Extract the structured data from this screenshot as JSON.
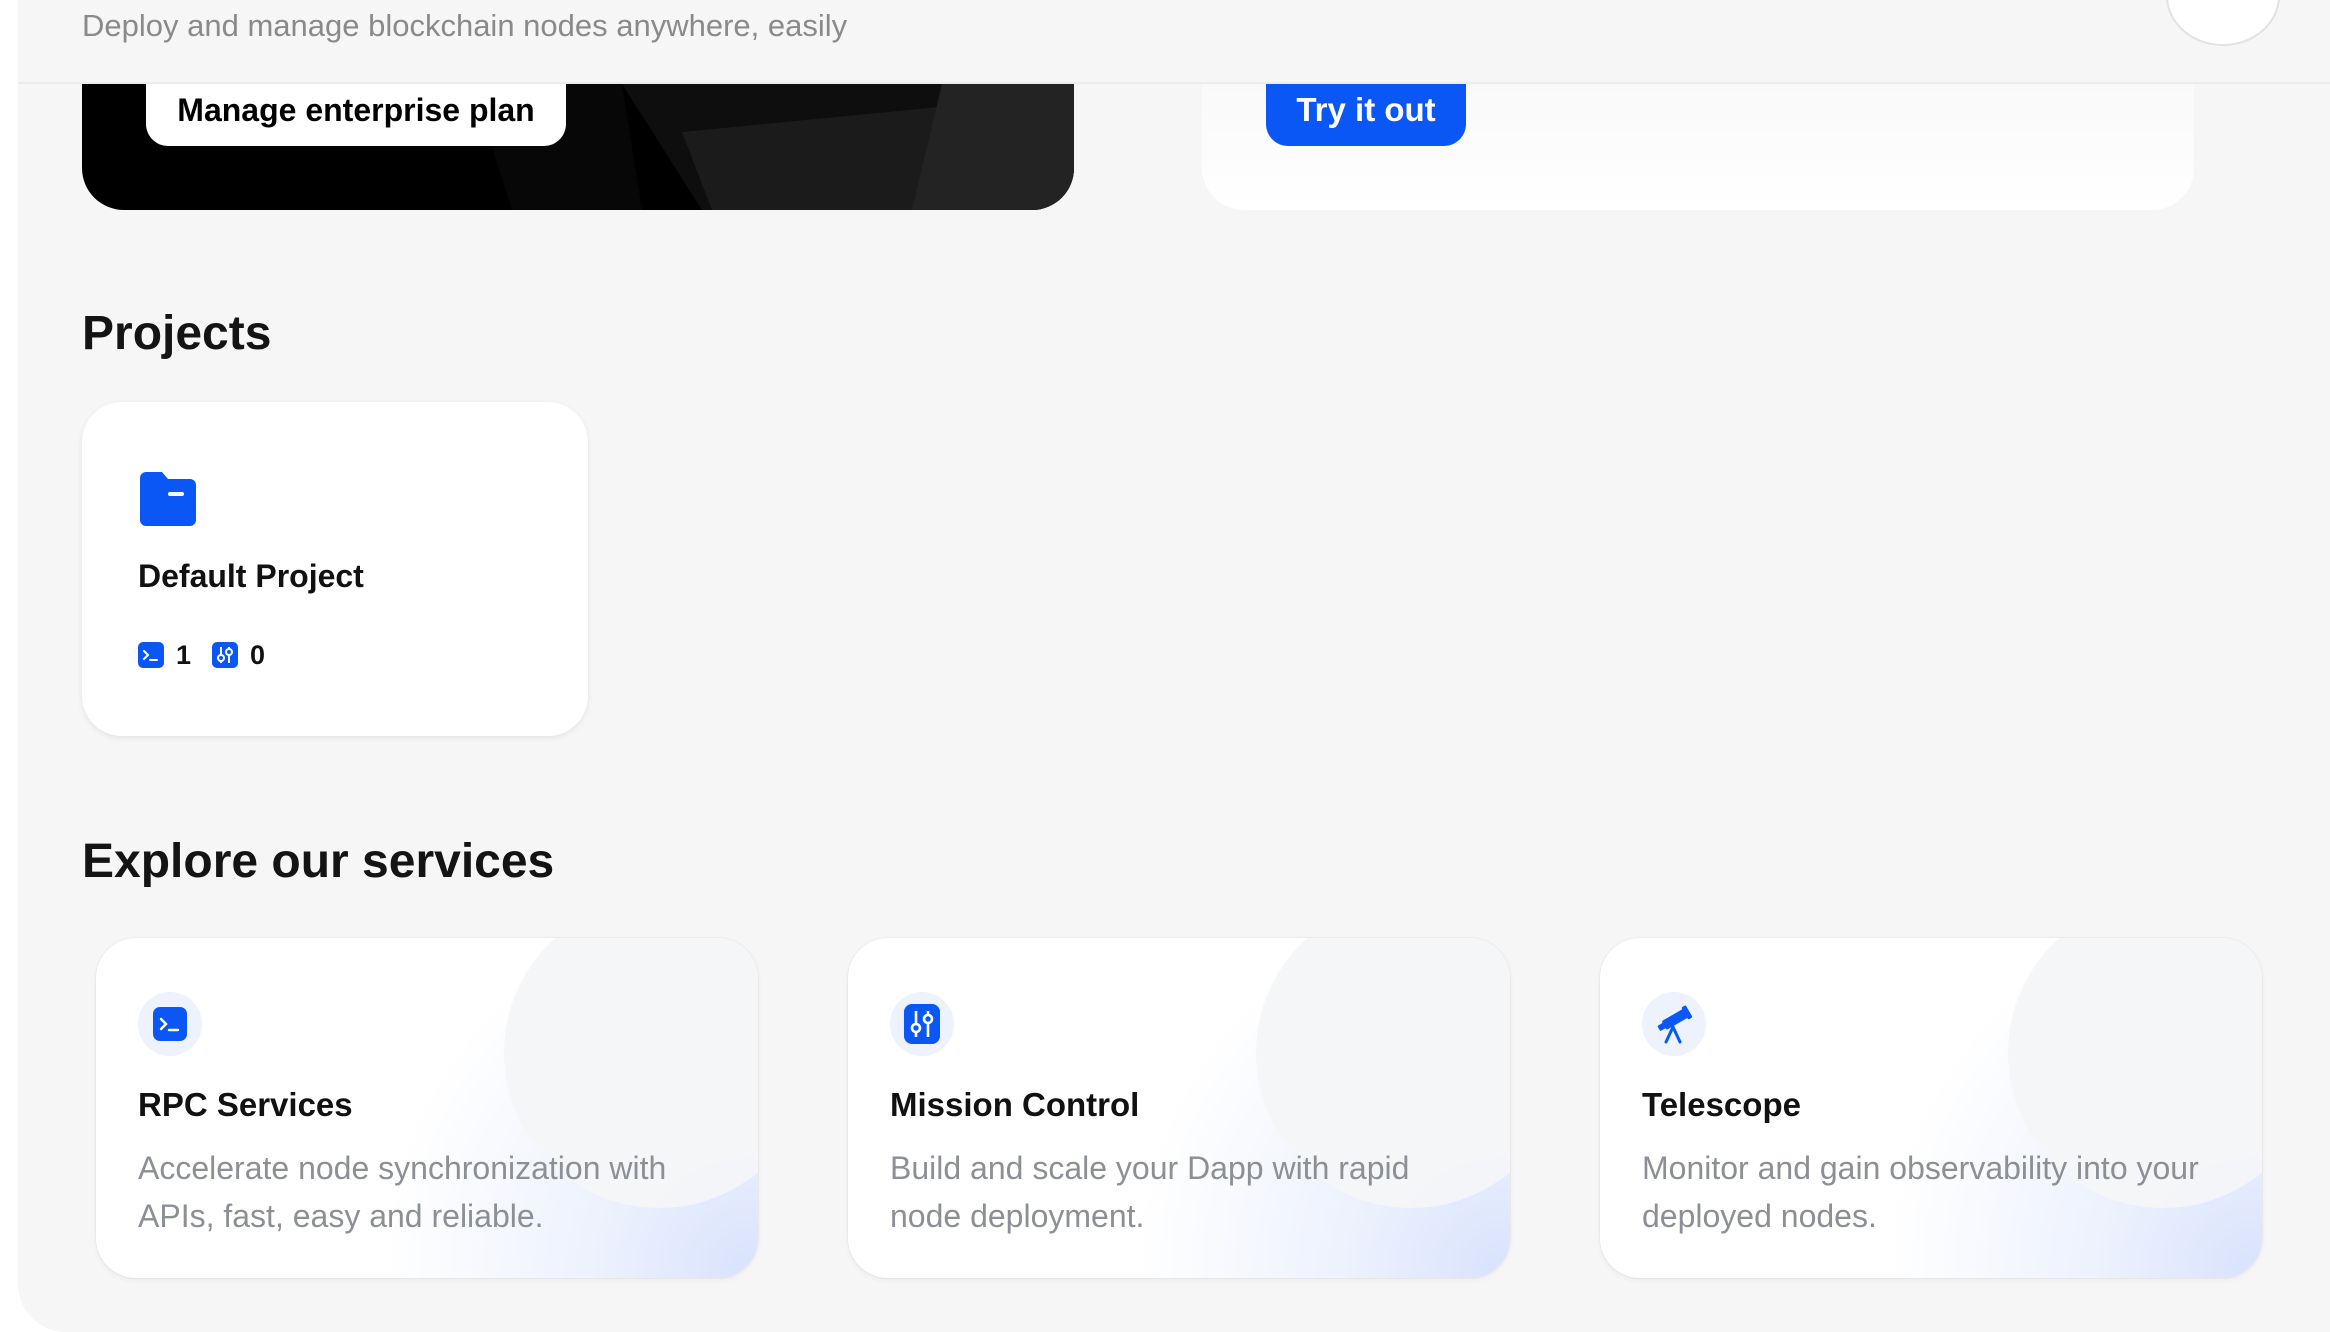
{
  "header": {
    "subtitle": "Deploy and manage blockchain nodes anywhere, easily"
  },
  "enterprise_card": {
    "button_label": "Manage enterprise plan",
    "background_color": "#000000"
  },
  "try_card": {
    "button_label": "Try it out",
    "button_color": "#0b57f5"
  },
  "projects": {
    "heading": "Projects",
    "items": [
      {
        "name": "Default Project",
        "icon": "folder-icon",
        "rpc_count": "1",
        "mission_control_count": "0"
      }
    ]
  },
  "services": {
    "heading": "Explore our services",
    "items": [
      {
        "title": "RPC Services",
        "description": "Accelerate node synchronization with APIs, fast, easy and reliable.",
        "icon": "terminal-icon"
      },
      {
        "title": "Mission Control",
        "description": "Build and scale your Dapp with rapid node deployment.",
        "icon": "sliders-icon"
      },
      {
        "title": "Telescope",
        "description": "Monitor and gain observability into your deployed nodes.",
        "icon": "telescope-icon"
      }
    ]
  },
  "theme": {
    "accent": "#0b57f5",
    "page_bg": "#f6f6f6",
    "card_bg": "#ffffff",
    "muted_text": "#8c8f96"
  }
}
